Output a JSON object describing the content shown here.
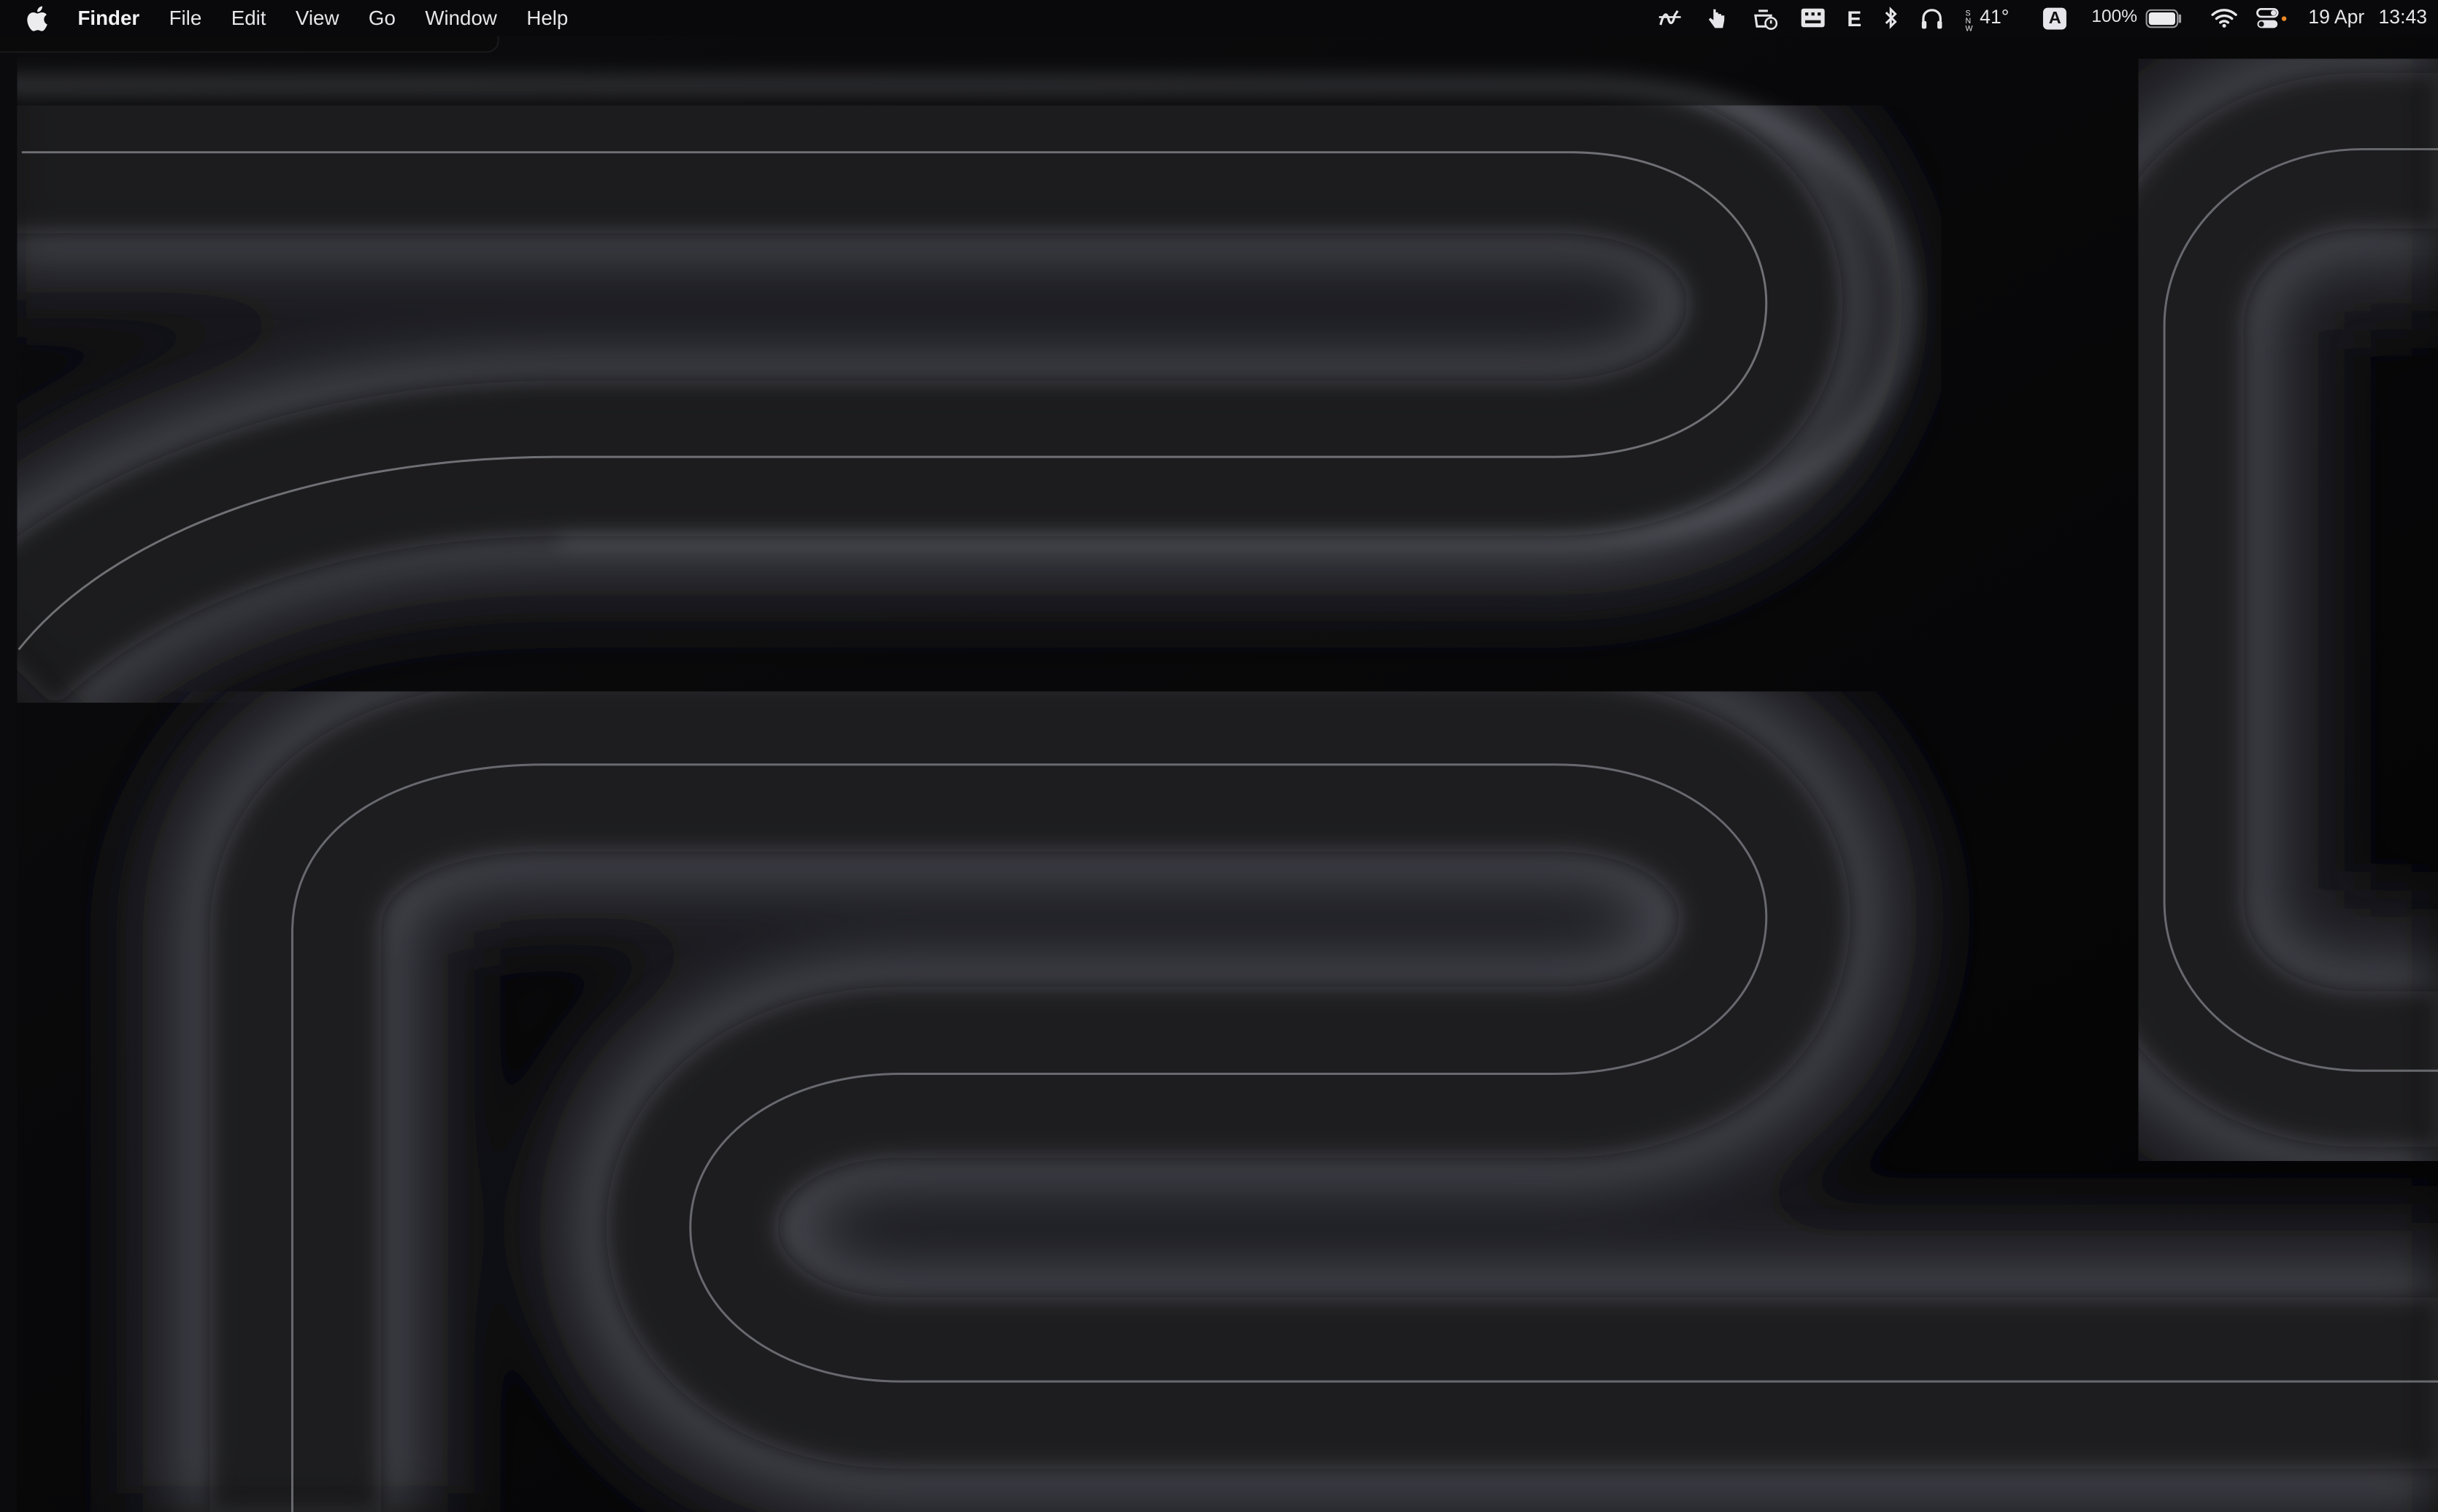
{
  "menubar": {
    "apple_icon": "apple-logo-icon",
    "app_name": "Finder",
    "menus": [
      "File",
      "Edit",
      "View",
      "Go",
      "Window",
      "Help"
    ],
    "status": {
      "weather_temp": "41°",
      "input_source": "A",
      "keyboard_letter": "E",
      "battery_percent": "100%",
      "battery_level": 1.0,
      "date": "19 Apr",
      "time": "13:43"
    }
  },
  "desktop": {
    "wallpaper": "dark-gray-tube-maze",
    "colors": {
      "background": "#050506",
      "tube_highlight": "#8a8c94",
      "tube_mid": "#3a3b40",
      "tube_dark": "#141416"
    }
  }
}
